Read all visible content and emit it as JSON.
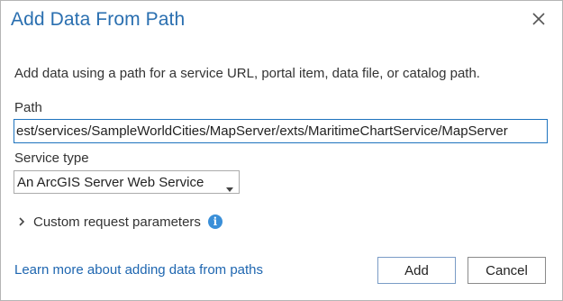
{
  "dialog": {
    "title": "Add Data From Path",
    "close_icon": "close-icon",
    "description": "Add data using a path for a service URL, portal item, data file, or catalog path.",
    "path": {
      "label": "Path",
      "value": "est/services/SampleWorldCities/MapServer/exts/MaritimeChartService/MapServer"
    },
    "service_type": {
      "label": "Service type",
      "selected": "An ArcGIS Server Web Service",
      "arrow_icon": "triangle-down-icon"
    },
    "custom_request": {
      "label": "Custom request parameters",
      "expander_icon": "chevron-right-icon",
      "info_icon": "info-icon",
      "info_glyph": "i"
    },
    "learn_more_link": "Learn more about adding data from paths",
    "buttons": {
      "add": "Add",
      "cancel": "Cancel"
    }
  },
  "colors": {
    "title": "#2a6fb0",
    "link": "#1e66b0",
    "info_icon": "#3a8fd8",
    "input_focus_border": "#1e73be"
  }
}
